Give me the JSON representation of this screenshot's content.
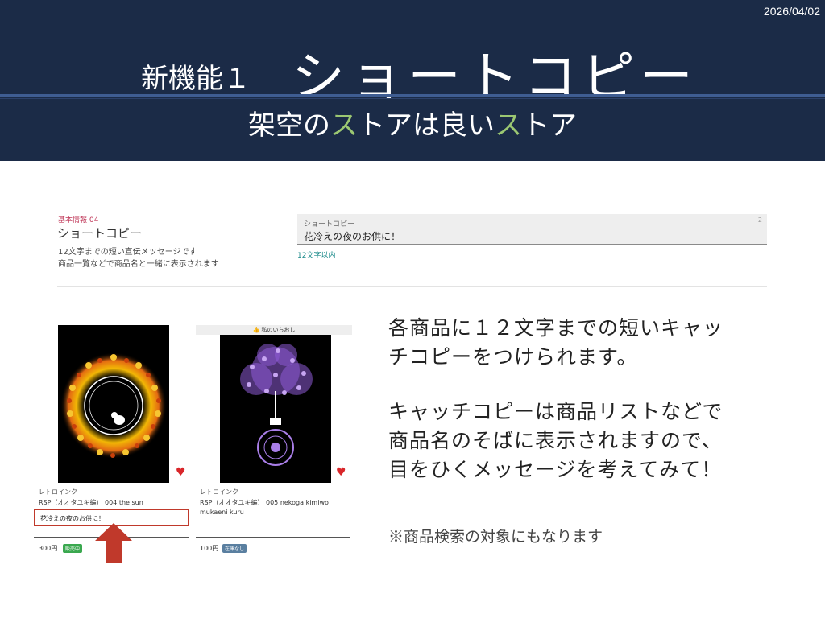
{
  "header": {
    "date": "2026/04/02",
    "feature_label": "新機能１",
    "title": "ショートコピー",
    "subtitle_parts": [
      "架空の",
      "ス",
      "トアは良い",
      "ス",
      "トア"
    ],
    "accent_color": "#9bc772",
    "background_color": "#1b2b47"
  },
  "form": {
    "category": "基本情報 04",
    "title": "ショートコピー",
    "description_lines": [
      "12文字までの短い宣伝メッセージです",
      "商品一覧などで商品名と一緒に表示されます"
    ],
    "field_label": "ショートコピー",
    "field_value": "花冷えの夜のお供に！",
    "field_count": "2",
    "field_hint": "12文字以内"
  },
  "products": [
    {
      "brand": "レトロインク",
      "name_lines": [
        "RSP（オオタユキ編） 004 the sun"
      ],
      "short_copy": "花冷えの夜のお供に！",
      "price": "300円",
      "badge": "販売中",
      "badge_color": "#3aa84f"
    },
    {
      "top_label": "👍 私のいちおし",
      "brand": "レトロインク",
      "name_lines": [
        "RSP（オオタユキ編） 005 nekoga kimiwo",
        "mukaeni kuru"
      ],
      "price": "100円",
      "badge": "在庫なし",
      "badge_color": "#5a7fa0"
    }
  ],
  "body": {
    "paragraph1_lines": [
      "各商品に１２文字までの短いキャッ",
      "チコピーをつけられます。"
    ],
    "paragraph2_lines": [
      "キャッチコピーは商品リストなどで",
      "商品名のそばに表示されますので、",
      "目をひくメッセージを考えてみて！"
    ],
    "note": "※商品検索の対象にもなります"
  },
  "icons": {
    "heart": "heart-icon",
    "arrow": "up-arrow-icon"
  }
}
